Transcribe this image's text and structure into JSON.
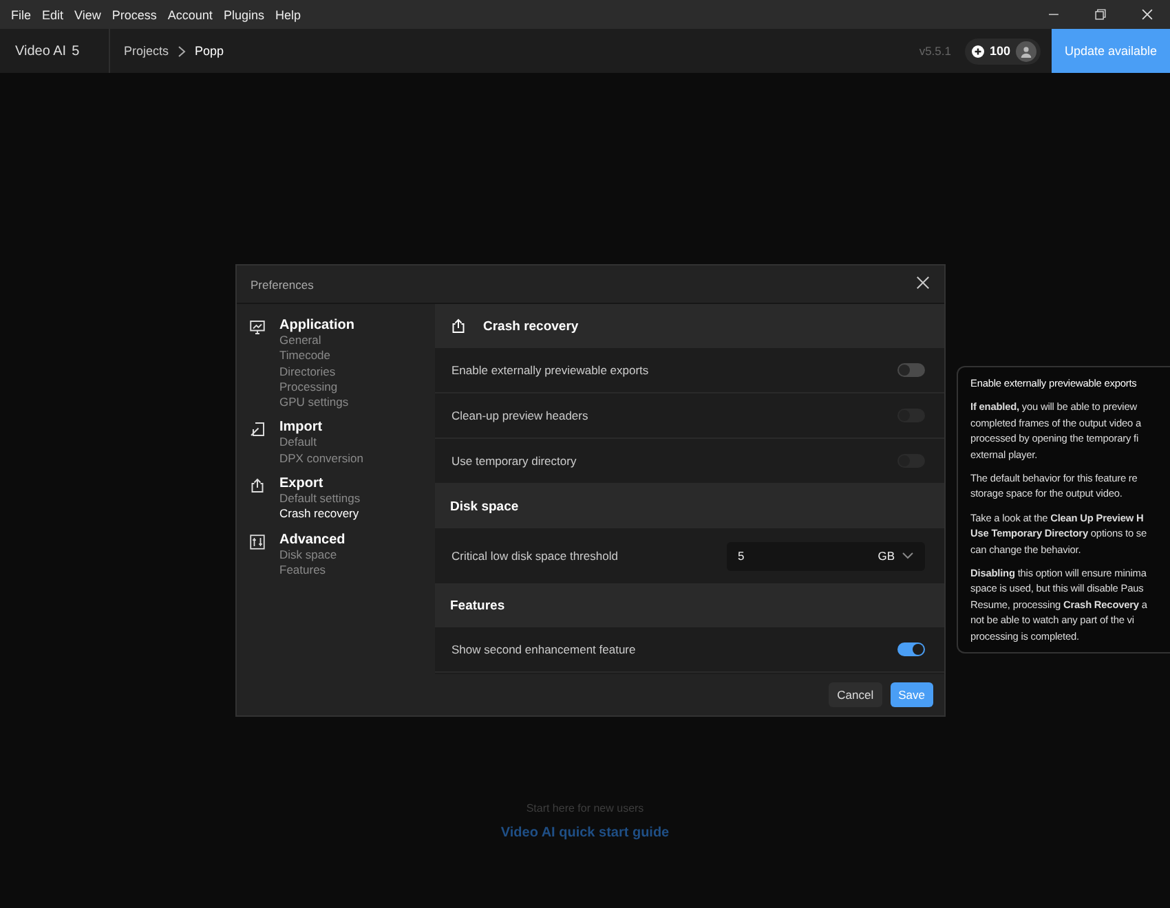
{
  "menu_bar": {
    "items": [
      "File",
      "Edit",
      "View",
      "Process",
      "Account",
      "Plugins",
      "Help"
    ]
  },
  "header": {
    "app_name": "Video AI",
    "app_version": "5",
    "breadcrumb": [
      "Projects",
      "Popp"
    ],
    "version": "v5.5.1",
    "credits": "100",
    "update_button": "Update available"
  },
  "dialog": {
    "title": "Preferences",
    "sidebar": [
      {
        "title": "Application",
        "items": [
          {
            "label": "General",
            "selected": false
          },
          {
            "label": "Timecode",
            "selected": false
          },
          {
            "label": "Directories",
            "selected": false
          },
          {
            "label": "Processing",
            "selected": false
          },
          {
            "label": "GPU settings",
            "selected": false
          }
        ]
      },
      {
        "title": "Import",
        "items": [
          {
            "label": "Default",
            "selected": false
          },
          {
            "label": "DPX conversion",
            "selected": false
          }
        ]
      },
      {
        "title": "Export",
        "items": [
          {
            "label": "Default settings",
            "selected": false
          },
          {
            "label": "Crash recovery",
            "selected": true
          }
        ]
      },
      {
        "title": "Advanced",
        "items": [
          {
            "label": "Disk space",
            "selected": false
          },
          {
            "label": "Features",
            "selected": false
          }
        ]
      }
    ],
    "sections": [
      {
        "title": "Crash recovery",
        "rows": [
          {
            "kind": "toggle",
            "label": "Enable externally previewable exports",
            "on": false,
            "disabled": false
          },
          {
            "kind": "toggle",
            "label": "Clean-up preview headers",
            "on": false,
            "disabled": true
          },
          {
            "kind": "toggle",
            "label": "Use temporary directory",
            "on": false,
            "disabled": true
          }
        ]
      },
      {
        "title": "Disk space",
        "rows": [
          {
            "kind": "number",
            "label": "Critical low disk space threshold",
            "value": "5",
            "unit": "GB"
          }
        ]
      },
      {
        "title": "Features",
        "rows": [
          {
            "kind": "toggle",
            "label": "Show second enhancement feature",
            "on": true,
            "disabled": false
          }
        ]
      }
    ],
    "buttons": [
      {
        "label": "Cancel",
        "kind": "secondary"
      },
      {
        "label": "Save",
        "kind": "primary"
      }
    ]
  },
  "tooltip": {
    "title": "Enable externally previewable exports",
    "paragraphs": [
      [
        "**If enabled,** you will be able to preview",
        "completed frames of the output video a",
        "processed by opening the temporary fi",
        "external player."
      ],
      [
        "The default behavior for this feature re",
        "storage space for the output video."
      ],
      [
        "Take a look at the **Clean Up Preview H**",
        "**Use Temporary Directory** options to se",
        "can change the behavior."
      ],
      [
        "**Disabling** this option will ensure minima",
        "space is used, but this will disable Paus",
        "Resume, processing **Crash Recovery** a",
        "not be able to watch any part of the vi",
        "processing is completed."
      ]
    ]
  },
  "start_guide": {
    "caption": "Start here for new users",
    "link": "Video AI quick start guide"
  }
}
